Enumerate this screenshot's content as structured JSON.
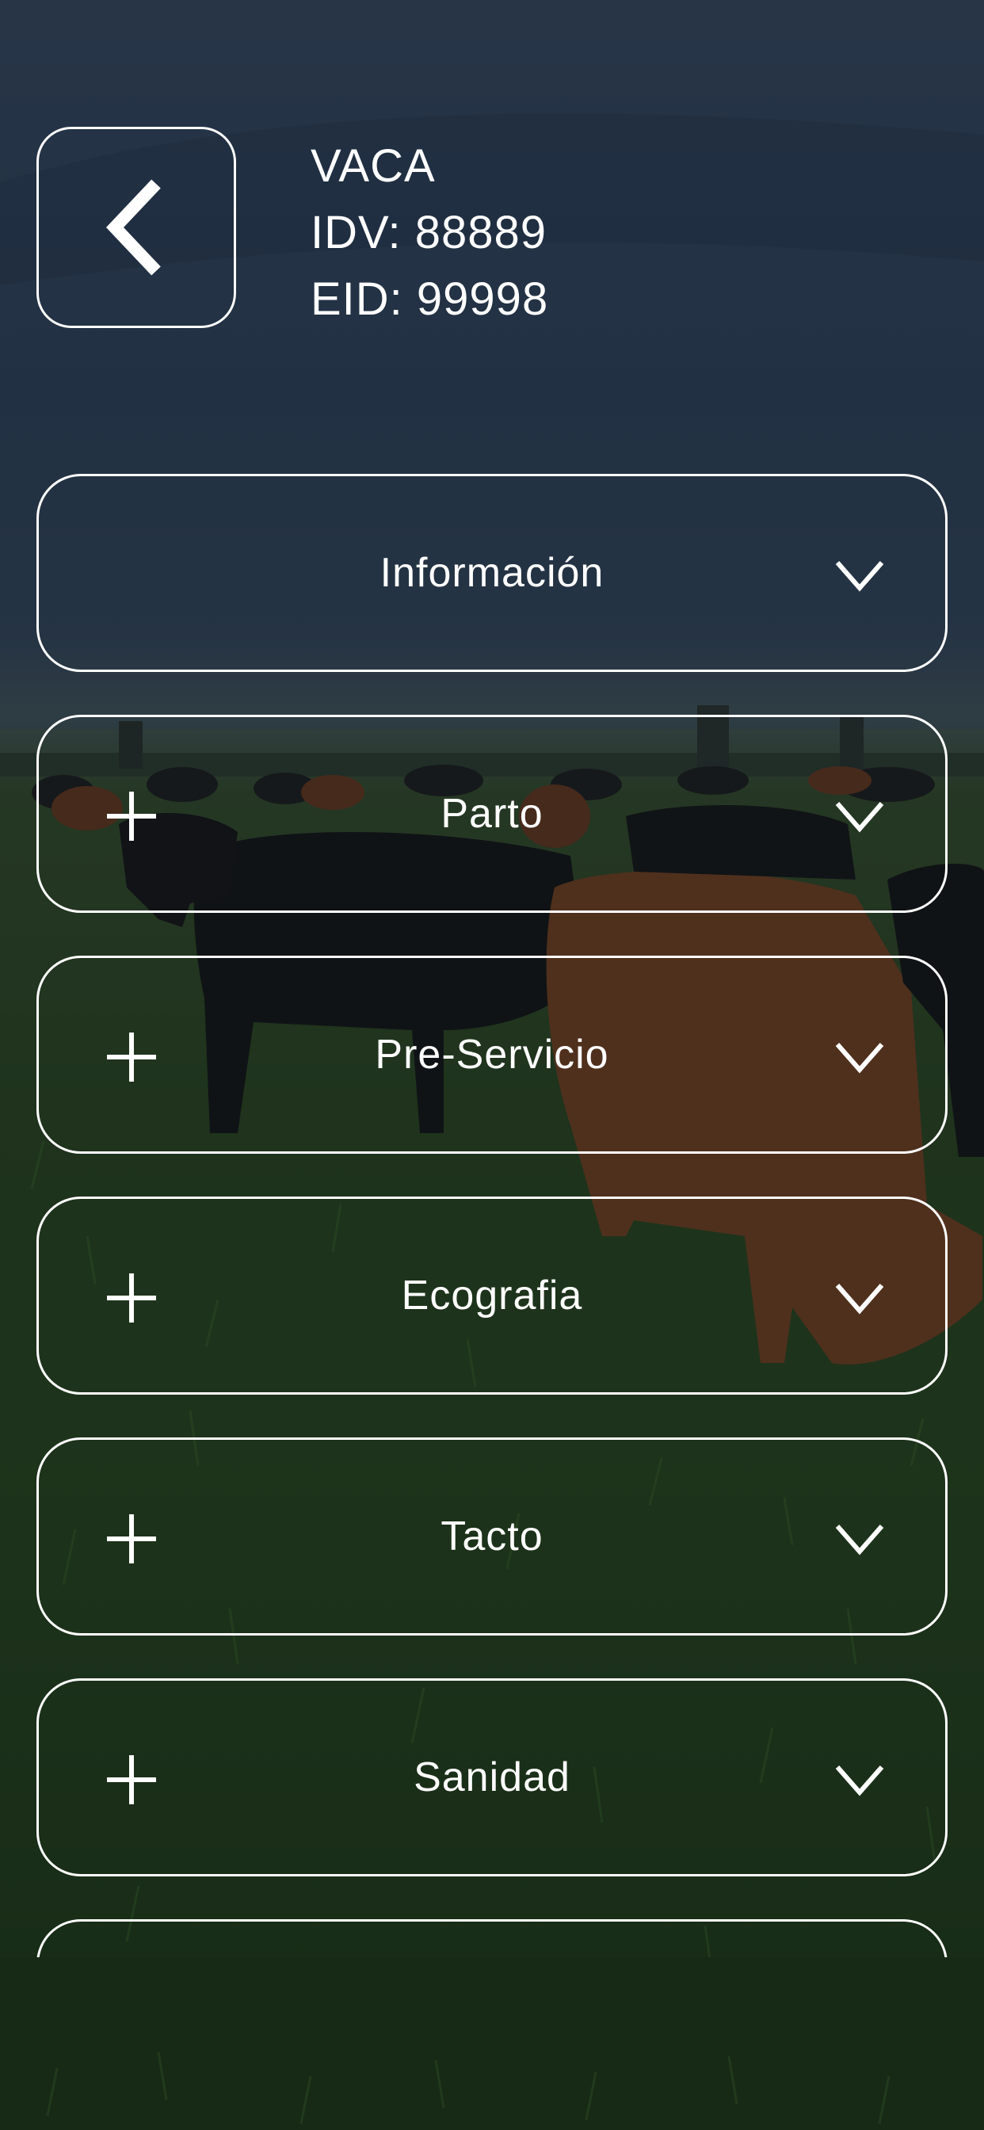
{
  "header": {
    "type_label": "VACA",
    "idv": "IDV: 88889",
    "eid": "EID: 99998"
  },
  "sections": [
    {
      "label": "Información",
      "has_add": false
    },
    {
      "label": "Parto",
      "has_add": true
    },
    {
      "label": "Pre-Servicio",
      "has_add": true
    },
    {
      "label": "Ecografia",
      "has_add": true
    },
    {
      "label": "Tacto",
      "has_add": true
    },
    {
      "label": "Sanidad",
      "has_add": true
    }
  ],
  "icons": {
    "back": "chevron-left-icon",
    "add": "plus-icon",
    "expand": "chevron-down-icon"
  },
  "colors": {
    "foreground": "#ffffff",
    "overlay": "rgba(10,16,20,0.38)"
  }
}
